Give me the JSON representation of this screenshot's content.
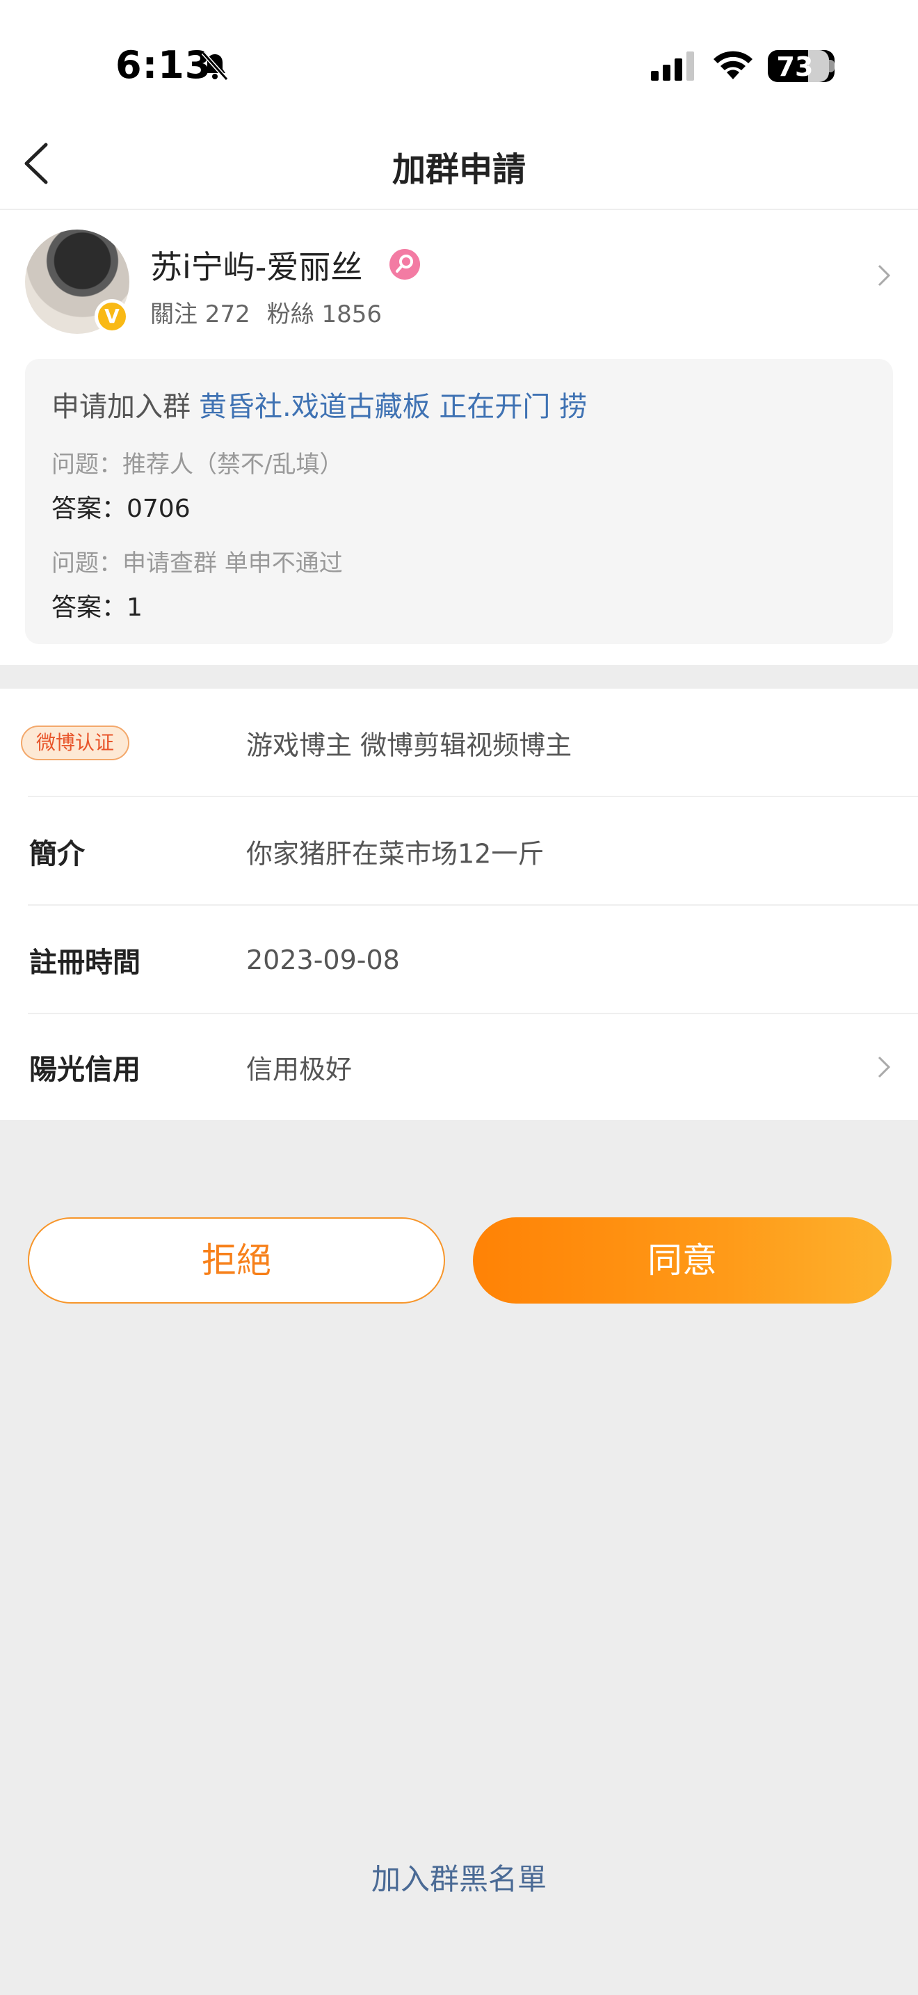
{
  "status_bar": {
    "time": "6:13",
    "battery": "73"
  },
  "nav": {
    "title": "加群申請"
  },
  "profile": {
    "name": "苏i宁屿-爱丽丝",
    "following": "關注 272",
    "followers": "粉絲 1856",
    "avatar_badge": "V"
  },
  "application": {
    "prefix": "申请加入群",
    "group_name": "黄昏社.戏道古藏板 正在开门 捞",
    "qa": [
      {
        "question": "问题：推荐人（禁不/乱填）",
        "answer": "答案：0706"
      },
      {
        "question": "问题：申请查群 单申不通过",
        "answer": "答案：1"
      }
    ]
  },
  "info": {
    "certification_badge": "微博认证",
    "certification_value": "游戏博主 微博剪辑视频博主",
    "bio_label": "簡介",
    "bio_value": "你家猪肝在菜市场12一斤",
    "register_label": "註冊時間",
    "register_value": "2023-09-08",
    "credit_label": "陽光信用",
    "credit_value": "信用极好"
  },
  "actions": {
    "reject": "拒絕",
    "accept": "同意",
    "blacklist": "加入群黑名單"
  },
  "colors": {
    "accent": "#ff8205",
    "link": "#3f72b3",
    "background": "#ededed"
  }
}
